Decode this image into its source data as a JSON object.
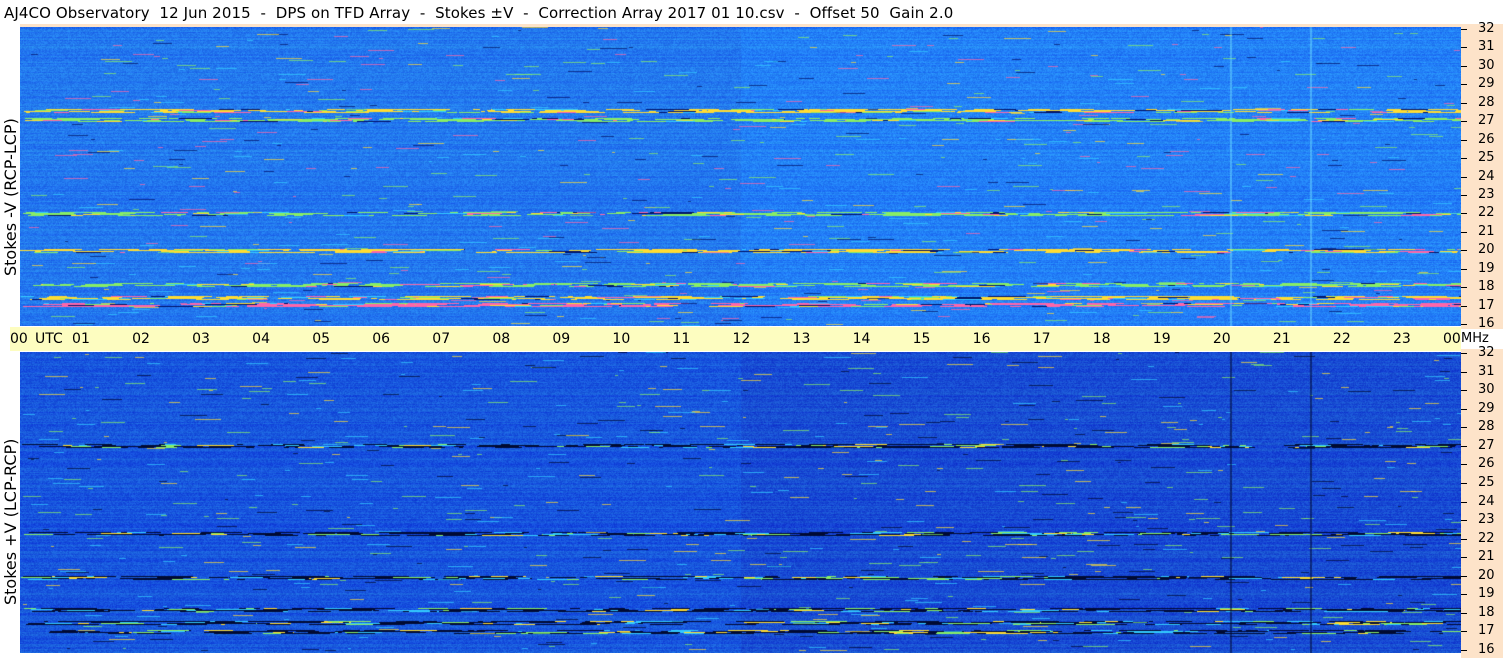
{
  "header": {
    "title": "AJ4CO Observatory  12 Jun 2015  -  DPS on TFD Array  -  Stokes ±V  -  Correction Array 2017 01 10.csv  -  Offset 50  Gain 2.0"
  },
  "chart_data": {
    "type": "heatmap",
    "panels": [
      {
        "label": "Stokes -V (RCP-LCP)",
        "freq_range_mhz": [
          16,
          32
        ],
        "freq_ticks": [
          "16",
          "17",
          "18",
          "19",
          "20",
          "21",
          "22",
          "23",
          "24",
          "25",
          "26",
          "27",
          "28",
          "29",
          "30",
          "31",
          "32"
        ],
        "base_color": "#2277ee",
        "accent_colors": [
          "#33ccff",
          "#88ee66",
          "#ffdd33",
          "#ff66aa",
          "#001166"
        ]
      },
      {
        "label": "Stokes +V (LCP-RCP)",
        "freq_range_mhz": [
          16,
          32
        ],
        "freq_ticks": [
          "16",
          "17",
          "18",
          "19",
          "20",
          "21",
          "22",
          "23",
          "24",
          "25",
          "26",
          "27",
          "28",
          "29",
          "30",
          "31",
          "32"
        ],
        "base_color": "#1755dd",
        "accent_colors": [
          "#000a33",
          "#33ccff",
          "#88ee66",
          "#ffdd33"
        ]
      }
    ],
    "time_axis": {
      "unit_label": "UTC",
      "freq_unit": "MHz",
      "hours": [
        "00",
        "01",
        "02",
        "03",
        "04",
        "05",
        "06",
        "07",
        "08",
        "09",
        "10",
        "11",
        "12",
        "13",
        "14",
        "15",
        "16",
        "17",
        "18",
        "19",
        "20",
        "21",
        "22",
        "23",
        "00"
      ],
      "range_hours": [
        0,
        24
      ]
    }
  }
}
